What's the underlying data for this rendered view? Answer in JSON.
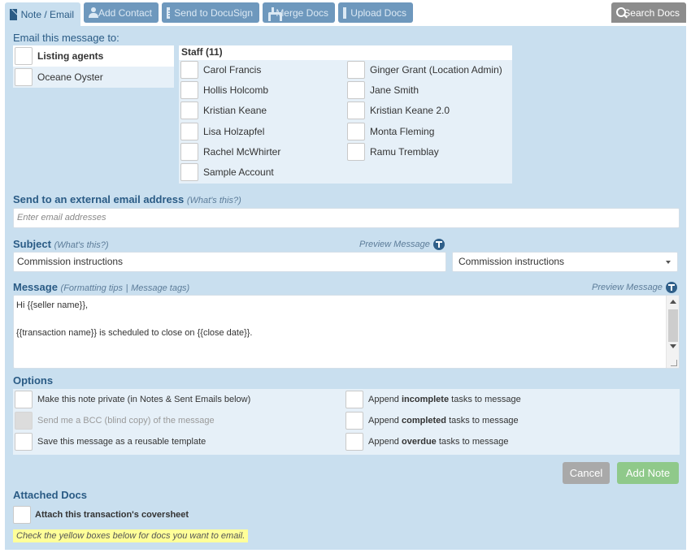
{
  "tabs": {
    "note_email": "Note / Email",
    "add_contact": "Add Contact",
    "send_docusign": "Send to DocuSign",
    "merge_docs": "Merge Docs",
    "upload_docs": "Upload Docs",
    "search_docs": "Search Docs"
  },
  "email_to": {
    "heading": "Email this message to:",
    "recipients": [
      "Listing agents",
      "Oceane Oyster"
    ]
  },
  "staff": {
    "heading": "Staff (11)",
    "left": [
      "Carol Francis",
      "Hollis Holcomb",
      "Kristian Keane",
      "Lisa Holzapfel",
      "Rachel McWhirter",
      "Sample Account"
    ],
    "right": [
      "Ginger Grant (Location Admin)",
      "Jane Smith",
      "Kristian Keane 2.0",
      "Monta Fleming",
      "Ramu Tremblay"
    ]
  },
  "external": {
    "heading": "Send to an external email address",
    "help": "(What's this?)",
    "placeholder": "Enter email addresses"
  },
  "subject": {
    "heading": "Subject",
    "help": "(What's this?)",
    "preview": "Preview Message",
    "value": "Commission instructions",
    "template_selected": "Commission instructions"
  },
  "message": {
    "heading": "Message",
    "formatting_tips": "(Formatting tips",
    "separator": "|",
    "message_tags": "Message tags)",
    "preview": "Preview Message",
    "line1": "Hi {{seller name}},",
    "line2": "",
    "line3": "{{transaction name}} is scheduled to close on {{close date}}."
  },
  "options": {
    "heading": "Options",
    "private": "Make this note private (in Notes & Sent Emails below)",
    "bcc": "Send me a BCC (blind copy) of the message",
    "template": "Save this message as a reusable template",
    "append_prefix": "Append",
    "append_suffix": "tasks to message",
    "incomplete": "incomplete",
    "completed": "completed",
    "overdue": "overdue"
  },
  "buttons": {
    "cancel": "Cancel",
    "add_note": "Add Note"
  },
  "attached": {
    "heading": "Attached Docs",
    "coversheet": "Attach this transaction's coversheet",
    "note": "Check the yellow boxes below for docs you want to email."
  },
  "colors": {
    "panel": "#c9dfef",
    "tab_button": "#6e98bd",
    "heading": "#2a5b85",
    "add_note": "#8fc98a",
    "cancel": "#a9a9a9",
    "highlight": "#ffff99"
  },
  "icons": {
    "note_email": "envelope-icon",
    "add_contact": "person-plus-icon",
    "send_docusign": "document-icon",
    "merge_docs": "merge-icon",
    "upload_docs": "upload-icon",
    "search_docs": "search-icon",
    "preview": "preview-icon"
  }
}
